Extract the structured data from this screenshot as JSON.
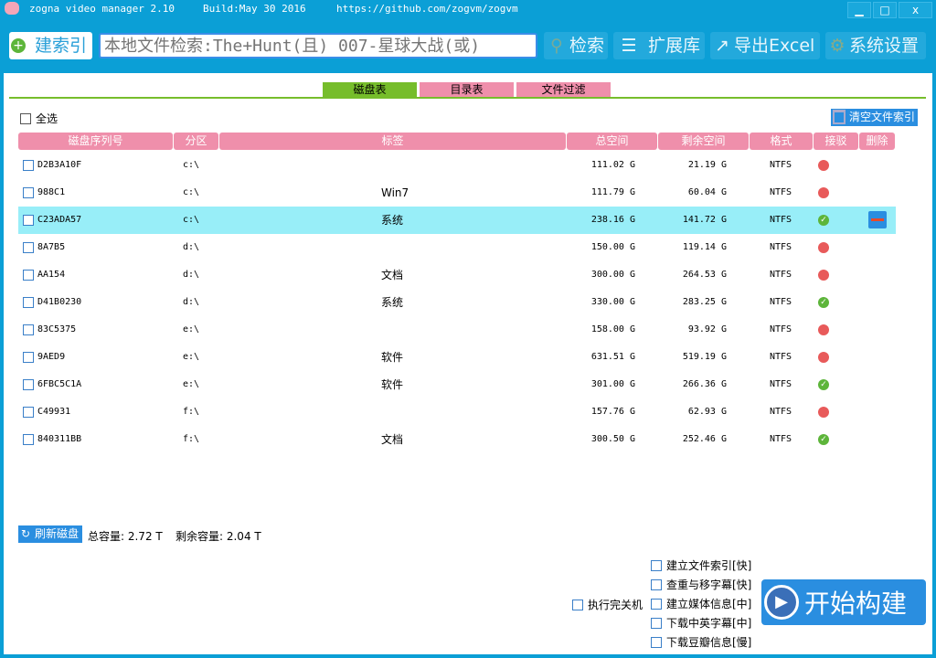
{
  "title": {
    "app": "zogna video manager 2.10",
    "build": "Build:May 30 2016",
    "url": "https://github.com/zogvm/zogvm"
  },
  "window": {
    "minimize": "▁",
    "maximize": "□",
    "close": "x"
  },
  "toolbar": {
    "build_index": "建索引",
    "search_placeholder": "本地文件检索:The+Hunt(且) 007-星球大战(或)",
    "search": "检索",
    "extensions": "扩展库",
    "export": "导出Excel",
    "settings": "系统设置"
  },
  "tabs": [
    "磁盘表",
    "目录表",
    "文件过滤"
  ],
  "select_all": "全选",
  "clear_index": "清空文件索引",
  "columns": [
    "磁盘序列号",
    "分区",
    "标签",
    "总空间",
    "剩余空间",
    "格式",
    "接驳",
    "删除"
  ],
  "rows": [
    {
      "serial": "D2B3A10F",
      "part": "c:\\",
      "label": "",
      "total": "111.02 G",
      "free": "21.19 G",
      "fmt": "NTFS",
      "connected": false
    },
    {
      "serial": "988C1",
      "part": "c:\\",
      "label": "Win7",
      "total": "111.79 G",
      "free": "60.04 G",
      "fmt": "NTFS",
      "connected": false
    },
    {
      "serial": "C23ADA57",
      "part": "c:\\",
      "label": "系统",
      "total": "238.16 G",
      "free": "141.72 G",
      "fmt": "NTFS",
      "connected": true,
      "selected": true
    },
    {
      "serial": "8A7B5",
      "part": "d:\\",
      "label": "",
      "total": "150.00 G",
      "free": "119.14 G",
      "fmt": "NTFS",
      "connected": false
    },
    {
      "serial": "AA154",
      "part": "d:\\",
      "label": "文档",
      "total": "300.00 G",
      "free": "264.53 G",
      "fmt": "NTFS",
      "connected": false
    },
    {
      "serial": "D41B0230",
      "part": "d:\\",
      "label": "系统",
      "total": "330.00 G",
      "free": "283.25 G",
      "fmt": "NTFS",
      "connected": true
    },
    {
      "serial": "83C5375",
      "part": "e:\\",
      "label": "",
      "total": "158.00 G",
      "free": "93.92 G",
      "fmt": "NTFS",
      "connected": false
    },
    {
      "serial": "9AED9",
      "part": "e:\\",
      "label": "软件",
      "total": "631.51 G",
      "free": "519.19 G",
      "fmt": "NTFS",
      "connected": false
    },
    {
      "serial": "6FBC5C1A",
      "part": "e:\\",
      "label": "软件",
      "total": "301.00 G",
      "free": "266.36 G",
      "fmt": "NTFS",
      "connected": true
    },
    {
      "serial": "C49931",
      "part": "f:\\",
      "label": "",
      "total": "157.76 G",
      "free": "62.93 G",
      "fmt": "NTFS",
      "connected": false
    },
    {
      "serial": "840311BB",
      "part": "f:\\",
      "label": "文档",
      "total": "300.50 G",
      "free": "252.46 G",
      "fmt": "NTFS",
      "connected": true
    }
  ],
  "footer": {
    "refresh": "刷新磁盘",
    "total": "总容量: 2.72 T",
    "free": "剩余容量: 2.04 T",
    "shutdown": "执行完关机",
    "start": "开始构建",
    "options": [
      "建立文件索引[快]",
      "查重与移字幕[快]",
      "建立媒体信息[中]",
      "下载中英字幕[中]",
      "下载豆瓣信息[慢]"
    ]
  }
}
